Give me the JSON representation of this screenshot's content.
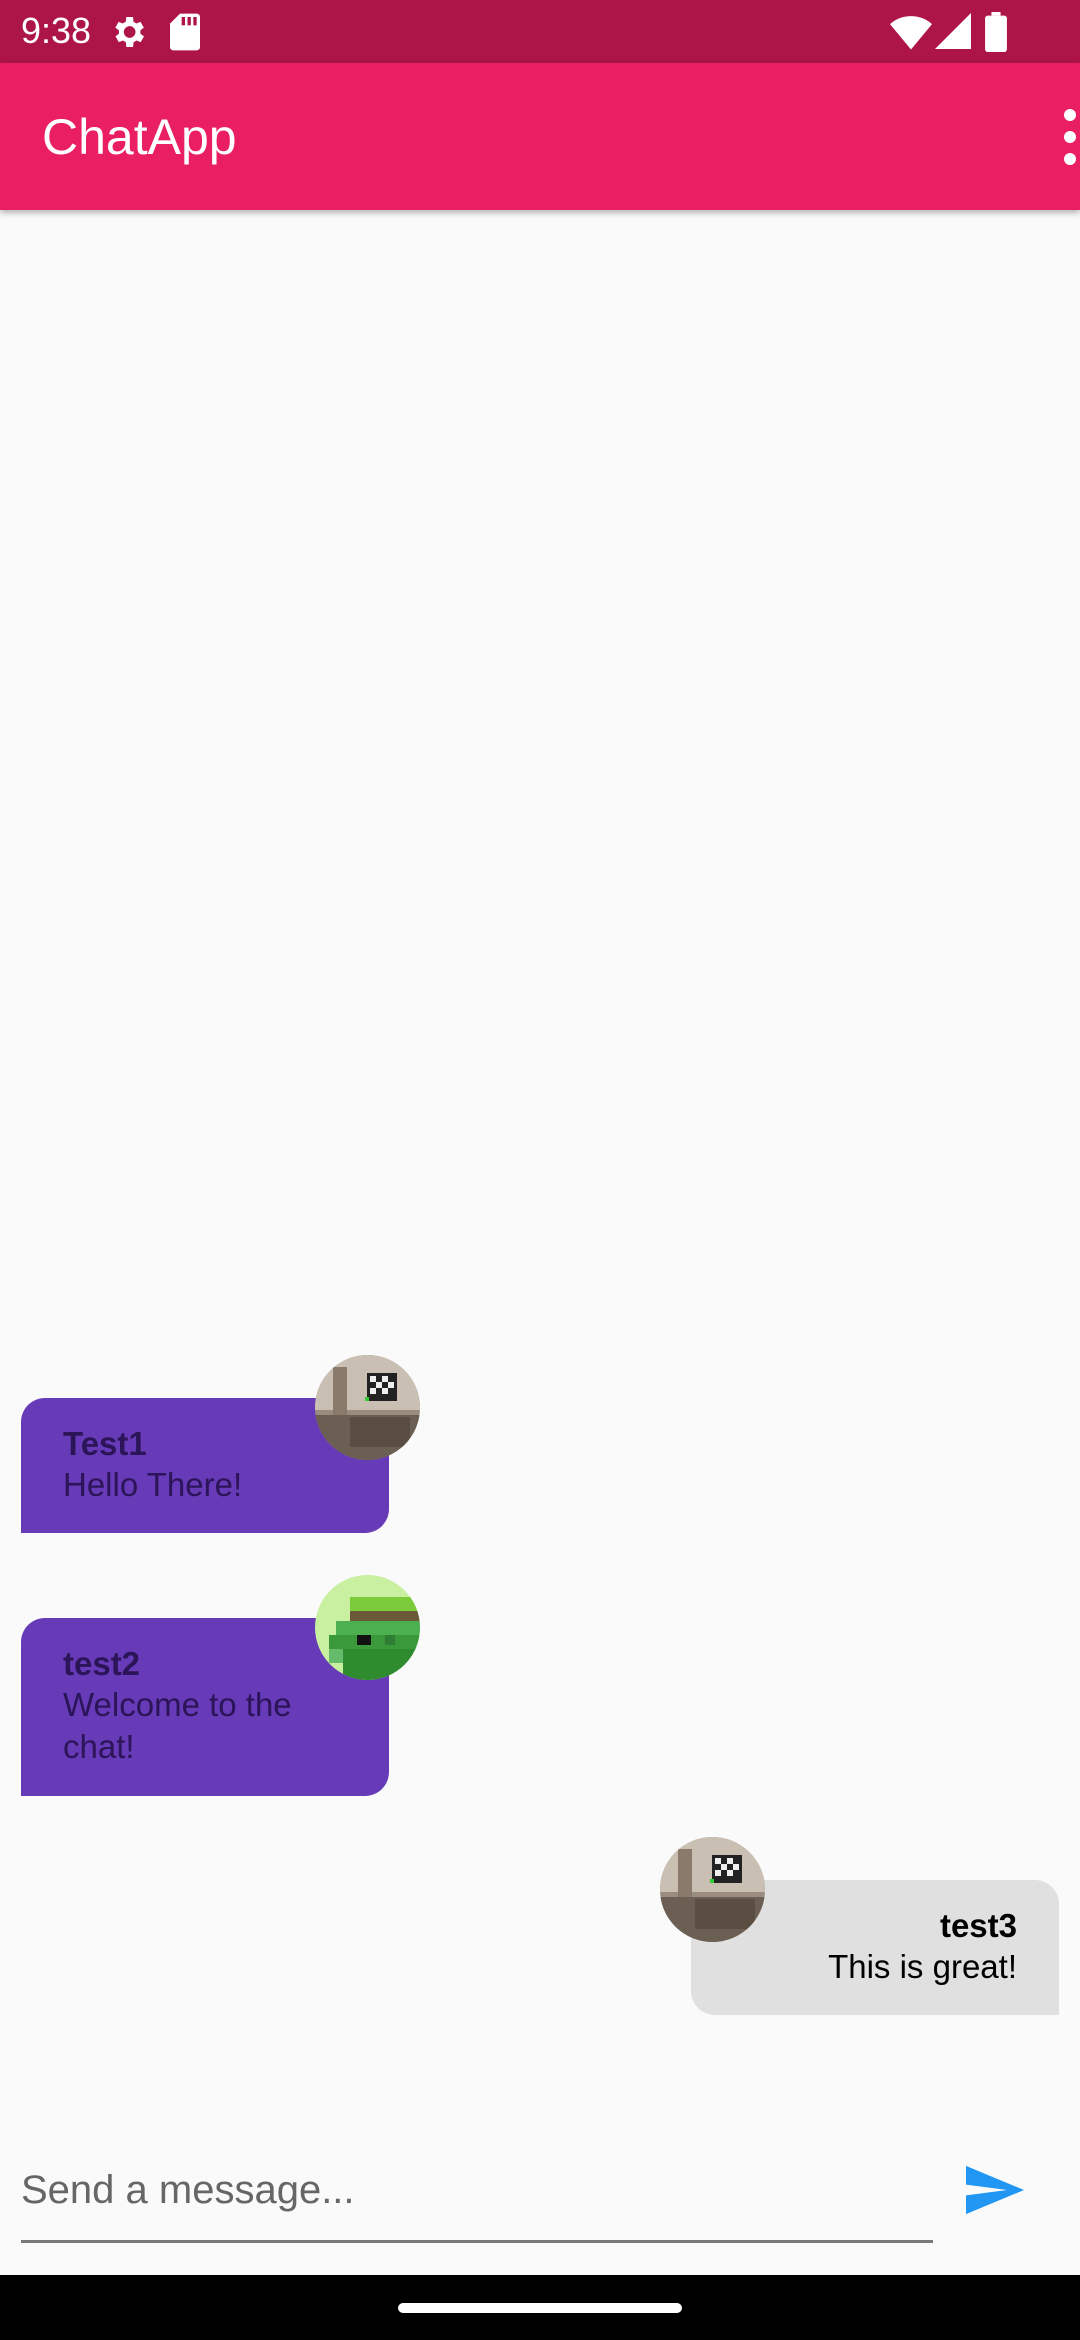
{
  "status_bar": {
    "time": "9:38",
    "icons": [
      "settings-gear-icon",
      "sd-card-icon",
      "wifi-icon",
      "signal-icon",
      "battery-icon"
    ]
  },
  "app_bar": {
    "title": "ChatApp",
    "menu_icon": "more-vert-icon"
  },
  "messages": [
    {
      "sender": "Test1",
      "text": "Hello There!",
      "is_me": false,
      "avatar": "room-photo-avatar"
    },
    {
      "sender": "test2",
      "text": "Welcome to the chat!",
      "is_me": false,
      "avatar": "pixel-art-avatar"
    },
    {
      "sender": "test3",
      "text": "This is great!",
      "is_me": true,
      "avatar": "room-photo-avatar"
    }
  ],
  "composer": {
    "placeholder": "Send a message...",
    "value": "",
    "send_icon": "send-icon"
  },
  "colors": {
    "status_bar": "#ad1549",
    "app_bar": "#e91e63",
    "other_bubble": "#673ab7",
    "self_bubble": "#e0e0e0",
    "send_icon": "#2196f3"
  }
}
